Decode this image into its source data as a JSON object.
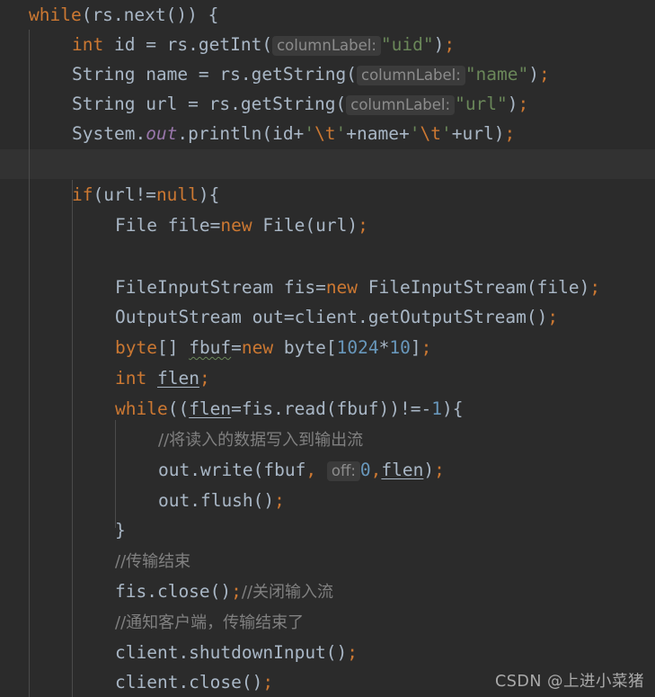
{
  "editor": {
    "theme": "darcula",
    "background": "#2b2b2b",
    "current_line_background": "#323232",
    "default_text_color": "#a9b7c6",
    "language": "Java",
    "colors": {
      "keyword": "#cc7832",
      "string": "#6a8759",
      "number": "#6897bb",
      "comment": "#808080",
      "static_field": "#9876aa",
      "parameter_hint_text": "#8c8c8c",
      "parameter_hint_background": "#3b3b3b",
      "indent_guide": "#4b4b4b",
      "warning_underline": "#6a8759"
    },
    "current_line_index": 5
  },
  "code": {
    "line_01": {
      "kw_while": "while",
      "open": "(rs.next()) {"
    },
    "line_02": {
      "kw_int": "int",
      "decl": " id = rs.getInt(",
      "hint": "columnLabel:",
      "string": "\"uid\"",
      "close": ")",
      "semi": ";"
    },
    "line_03": {
      "type": "String",
      "decl": " name = rs.getString(",
      "hint": "columnLabel:",
      "string": "\"name\"",
      "close": ")",
      "semi": ";"
    },
    "line_04": {
      "type": "String",
      "decl": " url = rs.getString(",
      "hint": "columnLabel:",
      "string": "\"url\"",
      "close": ")",
      "semi": ";"
    },
    "line_05": {
      "sys": "System.",
      "field": "out",
      "call": ".println(id+",
      "q1": "'",
      "esc1": "\\t",
      "q2": "'",
      "mid": "+name+",
      "q3": "'",
      "esc2": "\\t",
      "q4": "'",
      "tail": "+url)",
      "semi": ";"
    },
    "line_06": {
      "blank": ""
    },
    "line_07": {
      "kw_if": "if",
      "cond1": "(url!=",
      "kw_null": "null",
      "cond2": "){"
    },
    "line_08": {
      "type": "File",
      "decl": " file=",
      "kw_new": "new",
      "ctor": " File(url)",
      "semi": ";"
    },
    "line_09": {
      "blank": ""
    },
    "line_10": {
      "blank": ""
    },
    "line_11": {
      "type": "FileInputStream",
      "decl": " fis=",
      "kw_new": "new",
      "ctor": " FileInputStream(file)",
      "semi": ";"
    },
    "line_12": {
      "type": "OutputStream",
      "decl": " out=client.getOutputStream()",
      "semi": ";"
    },
    "line_13": {
      "kw_byte": "byte",
      "brackets": "[] ",
      "var": "fbuf",
      "eq": "=",
      "kw_new": "new",
      "type2": " byte",
      "open": "[",
      "num1": "1024",
      "star": "*",
      "num2": "10",
      "close": "]",
      "semi": ";"
    },
    "line_14": {
      "kw_int": "int",
      "sp": " ",
      "var": "flen",
      "semi": ";"
    },
    "line_15": {
      "kw_while": "while",
      "open": "((",
      "var": "flen",
      "expr": "=fis.read(fbuf))!=",
      "minus": "-",
      "num": "1",
      "close": "){"
    },
    "line_16": {
      "comment": "//将读入的数据写入到输出流"
    },
    "line_17": {
      "call": "out.write(fbuf",
      "comma1": ",",
      "sp": " ",
      "hint": "off:",
      "num": "0",
      "comma2": ",",
      "var": "flen",
      "close": ")",
      "semi": ";"
    },
    "line_18": {
      "call": "out.flush()",
      "semi": ";"
    },
    "line_19": {
      "brace": "}"
    },
    "line_20": {
      "comment": "//传输结束"
    },
    "line_21": {
      "call": "fis.close()",
      "semi": ";",
      "comment": "//关闭输入流"
    },
    "line_22": {
      "comment": "//通知客户端，传输结束了"
    },
    "line_23": {
      "call": "client.shutdownInput()",
      "semi": ";"
    },
    "line_24": {
      "call": "client.close()",
      "semi": ";"
    }
  },
  "watermark": {
    "text": "CSDN @上进小菜猪"
  }
}
